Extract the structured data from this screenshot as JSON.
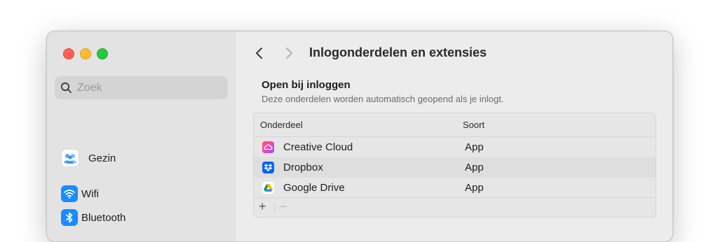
{
  "sidebar": {
    "search": {
      "placeholder": "Zoek"
    },
    "items": [
      {
        "label": "Gezin",
        "icon": "family-icon"
      },
      {
        "label": "Wifi",
        "icon": "wifi-icon"
      },
      {
        "label": "Bluetooth",
        "icon": "bluetooth-icon"
      }
    ]
  },
  "header": {
    "title": "Inlogonderdelen en extensies"
  },
  "login_items": {
    "title": "Open bij inloggen",
    "subtitle": "Deze onderdelen worden automatisch geopend als je inlogt.",
    "columns": [
      "Onderdeel",
      "Soort"
    ],
    "rows": [
      {
        "name": "Creative Cloud",
        "type": "App",
        "icon": "creative-cloud-icon"
      },
      {
        "name": "Dropbox",
        "type": "App",
        "icon": "dropbox-icon"
      },
      {
        "name": "Google Drive",
        "type": "App",
        "icon": "google-drive-icon"
      }
    ],
    "add_label": "+",
    "remove_label": "−"
  },
  "colors": {
    "accent": "#1a8cff",
    "close": "#ff5f57",
    "minimize": "#febc2e",
    "maximize": "#28c840"
  }
}
